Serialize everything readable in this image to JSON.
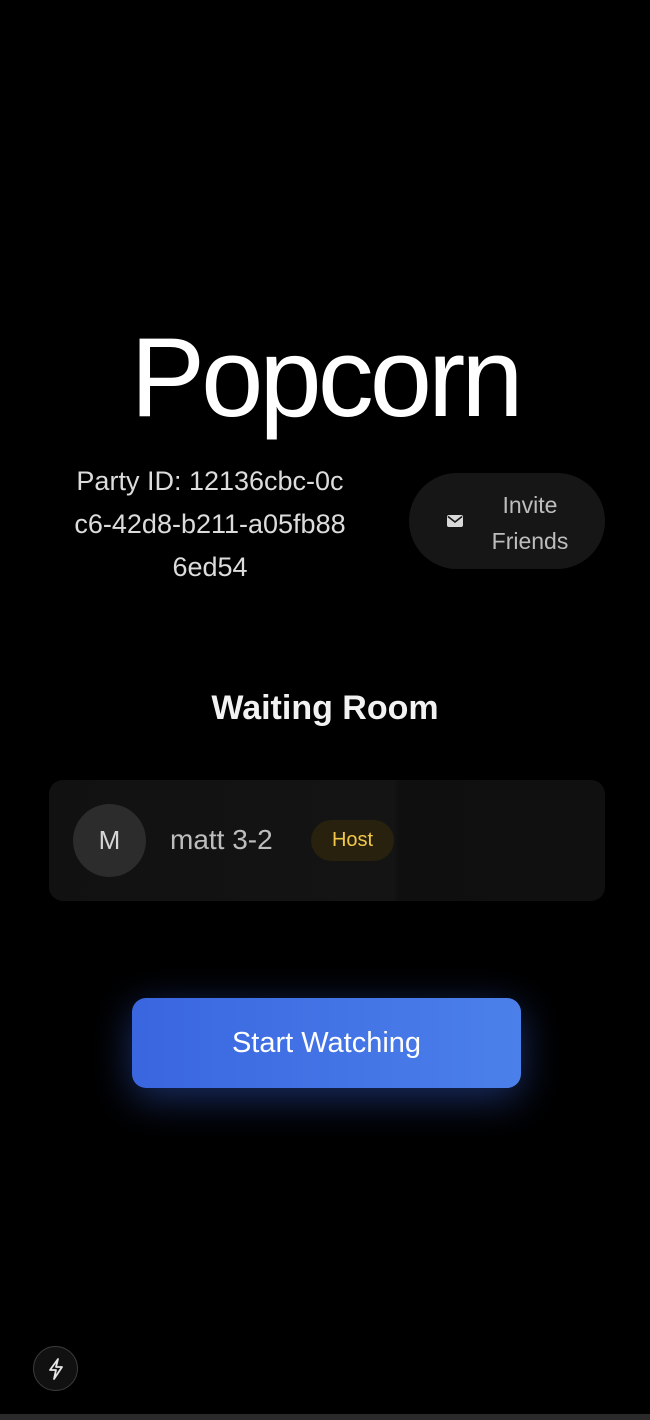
{
  "app": {
    "title": "Popcorn"
  },
  "party": {
    "id_text": "Party ID: 12136cbc-0cc6-42d8-b211-a05fb886ed54",
    "invite_label": "Invite Friends",
    "invite_icon": "mail-icon"
  },
  "waiting_room": {
    "title": "Waiting Room",
    "members": [
      {
        "initial": "M",
        "name": "matt 3-2",
        "badge": "Host"
      }
    ]
  },
  "actions": {
    "start_label": "Start Watching"
  },
  "dev_indicator": {
    "icon": "lightning-bolt-icon"
  },
  "colors": {
    "background": "#000000",
    "accent": "#3a66e0",
    "host_badge_text": "#f2c84b",
    "host_badge_bg": "#27210d"
  }
}
